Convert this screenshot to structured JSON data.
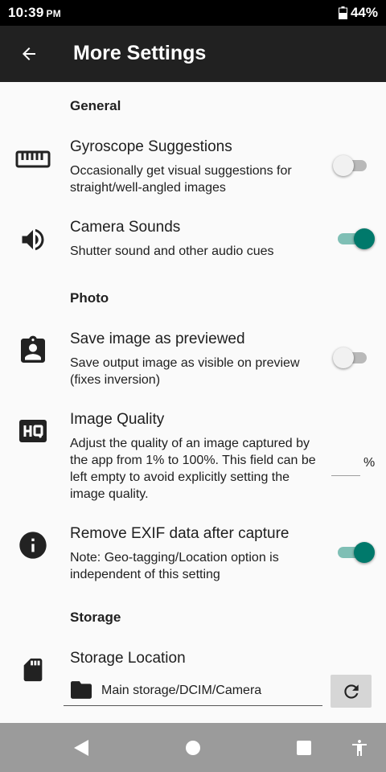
{
  "status_bar": {
    "time": "10:39",
    "ampm": "PM",
    "battery_level": "44%",
    "battery_icon": "battery-icon"
  },
  "app_bar": {
    "title": "More Settings",
    "back_icon": "arrow-back-icon"
  },
  "sections": {
    "general": "General",
    "photo": "Photo",
    "storage": "Storage"
  },
  "preferences": {
    "gyroscope": {
      "title": "Gyroscope Suggestions",
      "summary": "Occasionally get visual suggestions for straight/well-angled images",
      "enabled": false,
      "icon": "ruler-icon"
    },
    "camera_sounds": {
      "title": "Camera Sounds",
      "summary": "Shutter sound and other audio cues",
      "enabled": true,
      "icon": "volume-up-icon"
    },
    "save_as_previewed": {
      "title": "Save image as previewed",
      "summary": "Save output image as visible on preview (fixes inversion)",
      "enabled": false,
      "icon": "badge-icon"
    },
    "image_quality": {
      "title": "Image Quality",
      "summary": "Adjust the quality of an image captured by the app from 1% to 100%. This field can be left empty to avoid explicitly setting the image quality.",
      "value": "",
      "unit": "%",
      "icon": "hq-icon"
    },
    "remove_exif": {
      "title": "Remove EXIF data after capture",
      "summary": "Note: Geo-tagging/Location option is independent of this setting",
      "enabled": true,
      "icon": "info-icon"
    },
    "storage_location": {
      "title": "Storage Location",
      "path": "Main storage/DCIM/Camera",
      "icon": "sd-card-icon",
      "folder_icon": "folder-icon",
      "refresh_icon": "refresh-icon"
    }
  },
  "nav_bar": {
    "back": "nav-back-icon",
    "home": "nav-home-icon",
    "recents": "nav-recents-icon",
    "accessibility": "accessibility-icon"
  },
  "colors": {
    "app_bar": "#212121",
    "accent": "#00796b",
    "accent_track": "#7fbfb5",
    "background": "#fafafa",
    "nav_bar": "#9b9b9b"
  }
}
